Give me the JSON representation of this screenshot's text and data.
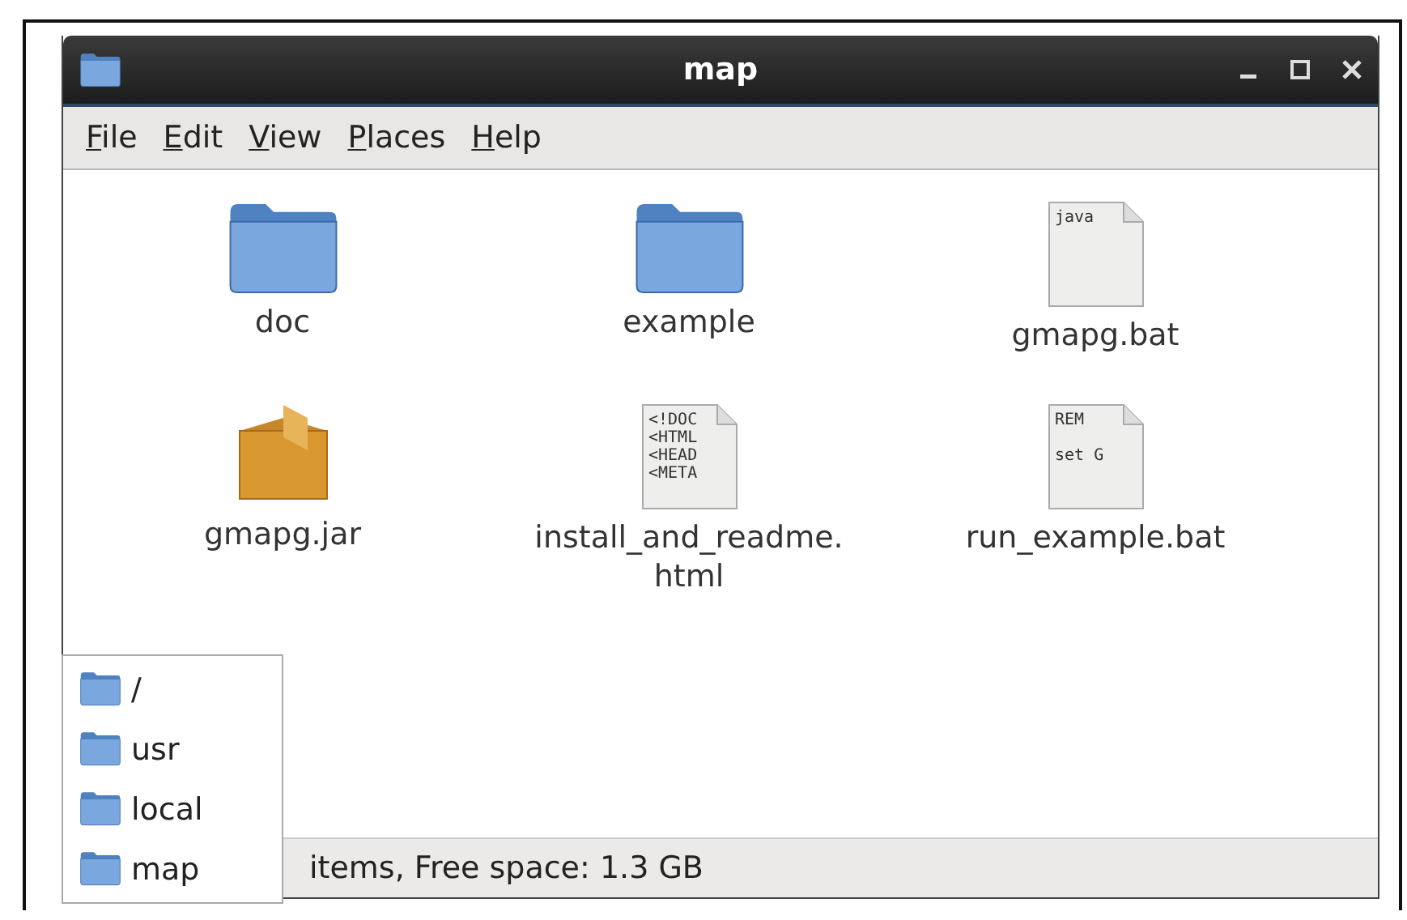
{
  "window": {
    "title": "map"
  },
  "menu": [
    "File",
    "Edit",
    "View",
    "Places",
    "Help"
  ],
  "files": [
    {
      "kind": "folder",
      "name": "doc"
    },
    {
      "kind": "folder",
      "name": "example"
    },
    {
      "kind": "text",
      "name": "gmapg.bat",
      "preview": "java"
    },
    {
      "kind": "package",
      "name": "gmapg.jar"
    },
    {
      "kind": "text",
      "name": "install_and_readme.\nhtml",
      "preview": "<!DOC\n<HTML\n<HEAD\n<META"
    },
    {
      "kind": "text",
      "name": "run_example.bat",
      "preview": "REM\n\nset G"
    }
  ],
  "path_popup": [
    "/",
    "usr",
    "local",
    "map"
  ],
  "status_bar": "items, Free space: 1.3 GB"
}
